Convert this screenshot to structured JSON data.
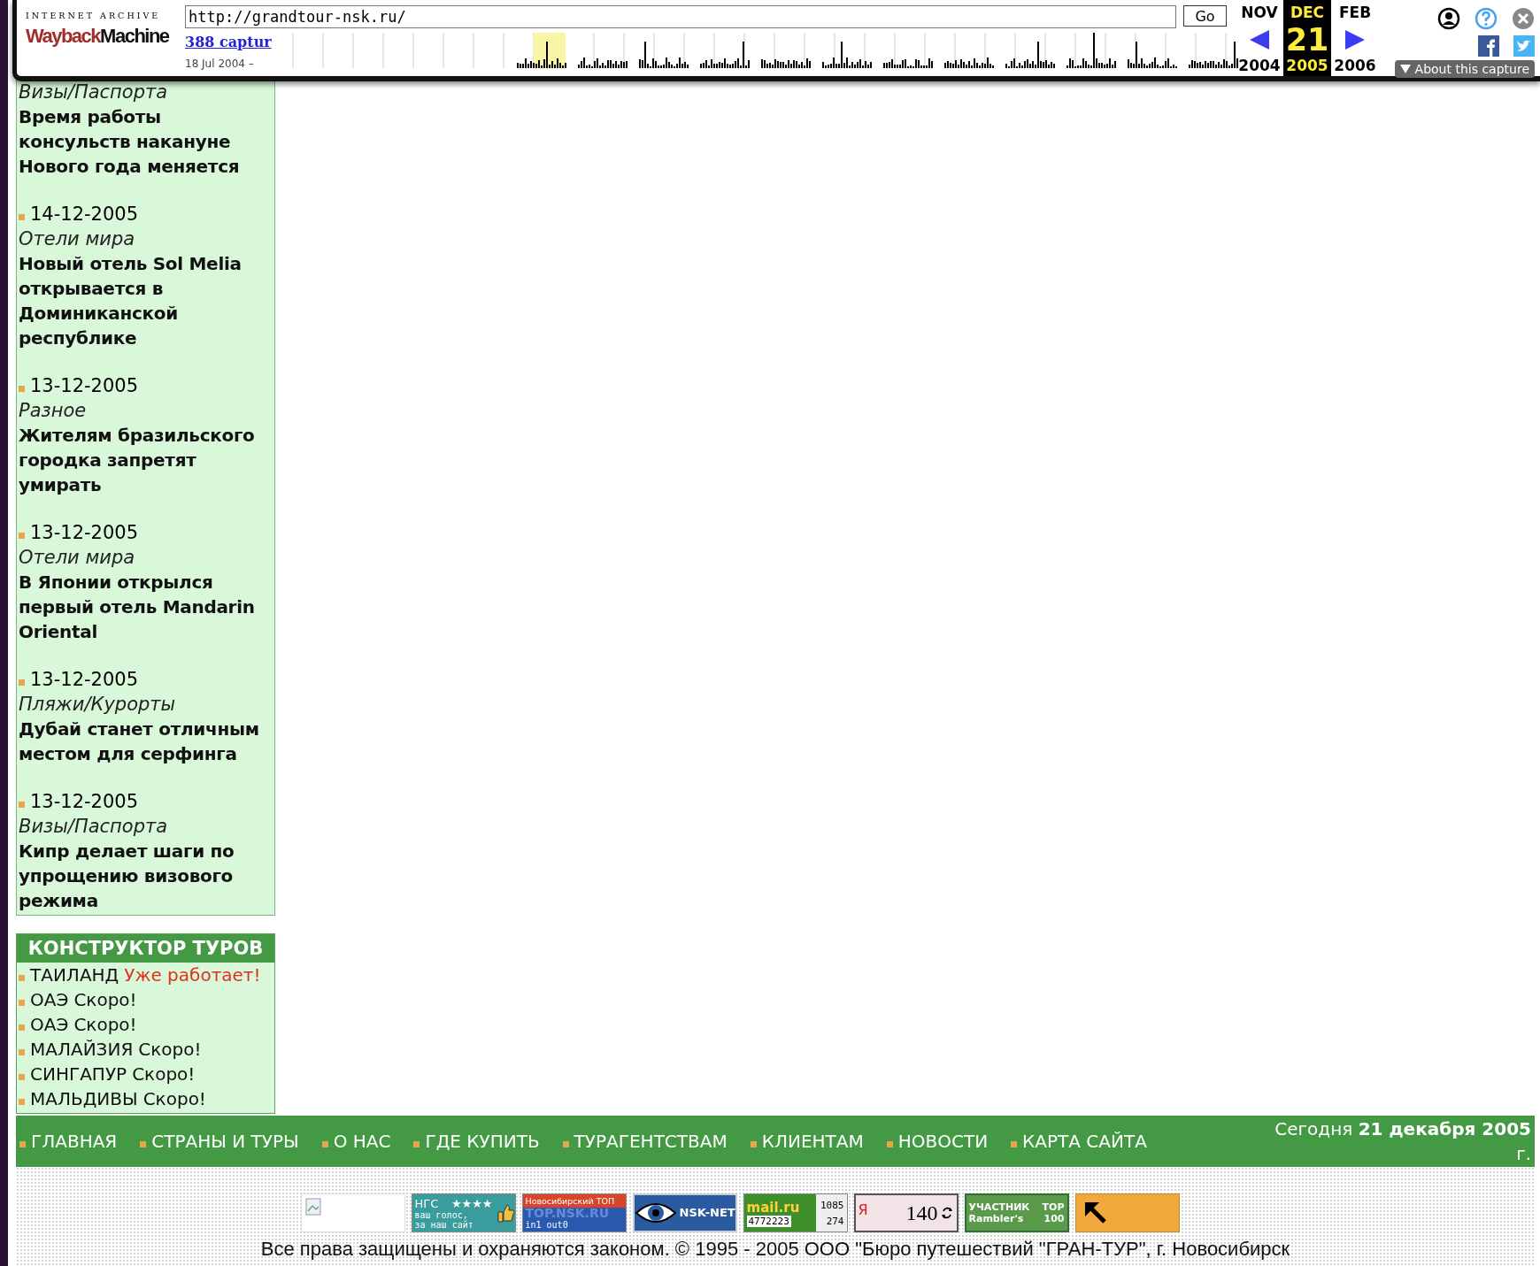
{
  "wayback": {
    "logo_top": "INTERNET ARCHIVE",
    "logo": [
      "Wayback",
      "Machine"
    ],
    "url": "http://grandtour-nsk.ru/",
    "go": "Go",
    "captures": "388 captur",
    "date_range": "18 Jul 2004 –",
    "months": [
      {
        "month": "NOV",
        "year": "2004",
        "selected": false
      },
      {
        "month": "DEC",
        "day": "21",
        "year": "2005",
        "selected": true
      },
      {
        "month": "FEB",
        "year": "2006",
        "selected": false
      }
    ],
    "about": "About this capture"
  },
  "news": [
    {
      "category": "Визы/Паспорта",
      "title": "Время работы консульств накануне Нового года меняется"
    },
    {
      "date": "14-12-2005",
      "category": "Отели мира",
      "title": "Новый отель Sol Melia открывается в Доминиканской республике"
    },
    {
      "date": "13-12-2005",
      "category": "Разное",
      "title": "Жителям бразильского городка запретят умирать"
    },
    {
      "date": "13-12-2005",
      "category": "Отели мира",
      "title": "В Японии открылся первый отель Mandarin Oriental"
    },
    {
      "date": "13-12-2005",
      "category": "Пляжи/Курорты",
      "title": "Дубай станет отличным местом для серфинга"
    },
    {
      "date": "13-12-2005",
      "category": "Визы/Паспорта",
      "title": "Кипр делает шаги по упрощению визового режима"
    }
  ],
  "constructor": {
    "title": "КОНСТРУКТОР ТУРОВ",
    "items": [
      {
        "country": "ТАИЛАНД",
        "status": "Уже работает!",
        "kind": "active"
      },
      {
        "country": "ОАЭ",
        "status": "Скоро!",
        "kind": "soon"
      },
      {
        "country": "ОАЭ",
        "status": "Скоро!",
        "kind": "soon"
      },
      {
        "country": "МАЛАЙЗИЯ",
        "status": "Скоро!",
        "kind": "soon"
      },
      {
        "country": "СИНГАПУР",
        "status": "Скоро!",
        "kind": "soon"
      },
      {
        "country": "МАЛЬДИВЫ",
        "status": "Скоро!",
        "kind": "soon"
      }
    ]
  },
  "nav": {
    "items": [
      "ГЛАВНАЯ",
      "СТРАНЫ И ТУРЫ",
      "О НАС",
      "ГДЕ КУПИТЬ",
      "ТУРАГЕНТСТВАМ",
      "КЛИЕНТАМ",
      "НОВОСТИ",
      "КАРТА САЙТА"
    ],
    "today": "Сегодня **21 декабря 2005** г."
  },
  "counters": [
    {
      "kind": "broken"
    },
    {
      "kind": "ngs",
      "rows": [
        [
          "НГС",
          "★★★★"
        ],
        [
          "ваш голос,"
        ],
        [
          "за наш сайт"
        ]
      ]
    },
    {
      "kind": "nsktop",
      "rows": [
        [
          "Новосибирский ТОП"
        ],
        [
          "TOP.NSK.RU"
        ],
        [
          "in1 out0"
        ]
      ]
    },
    {
      "kind": "nsknet",
      "rows": [
        [
          "NSK-NET"
        ]
      ]
    },
    {
      "kind": "mailru",
      "rows": [
        [
          "mail.ru",
          "1085"
        ],
        [
          "4772223",
          "274"
        ]
      ]
    },
    {
      "kind": "yandex",
      "rows": [
        [
          "Я",
          "140"
        ]
      ]
    },
    {
      "kind": "rambler",
      "rows": [
        [
          "УЧАСТНИК",
          "TOP"
        ],
        [
          "Rambler's",
          "100"
        ]
      ]
    },
    {
      "kind": "arrow"
    }
  ],
  "copyright": "Все права защищены и охраняются законом. © 1995 - 2005 ООО \"Бюро путешествий \"ГРАН-ТУР\", г. Новосибирск"
}
